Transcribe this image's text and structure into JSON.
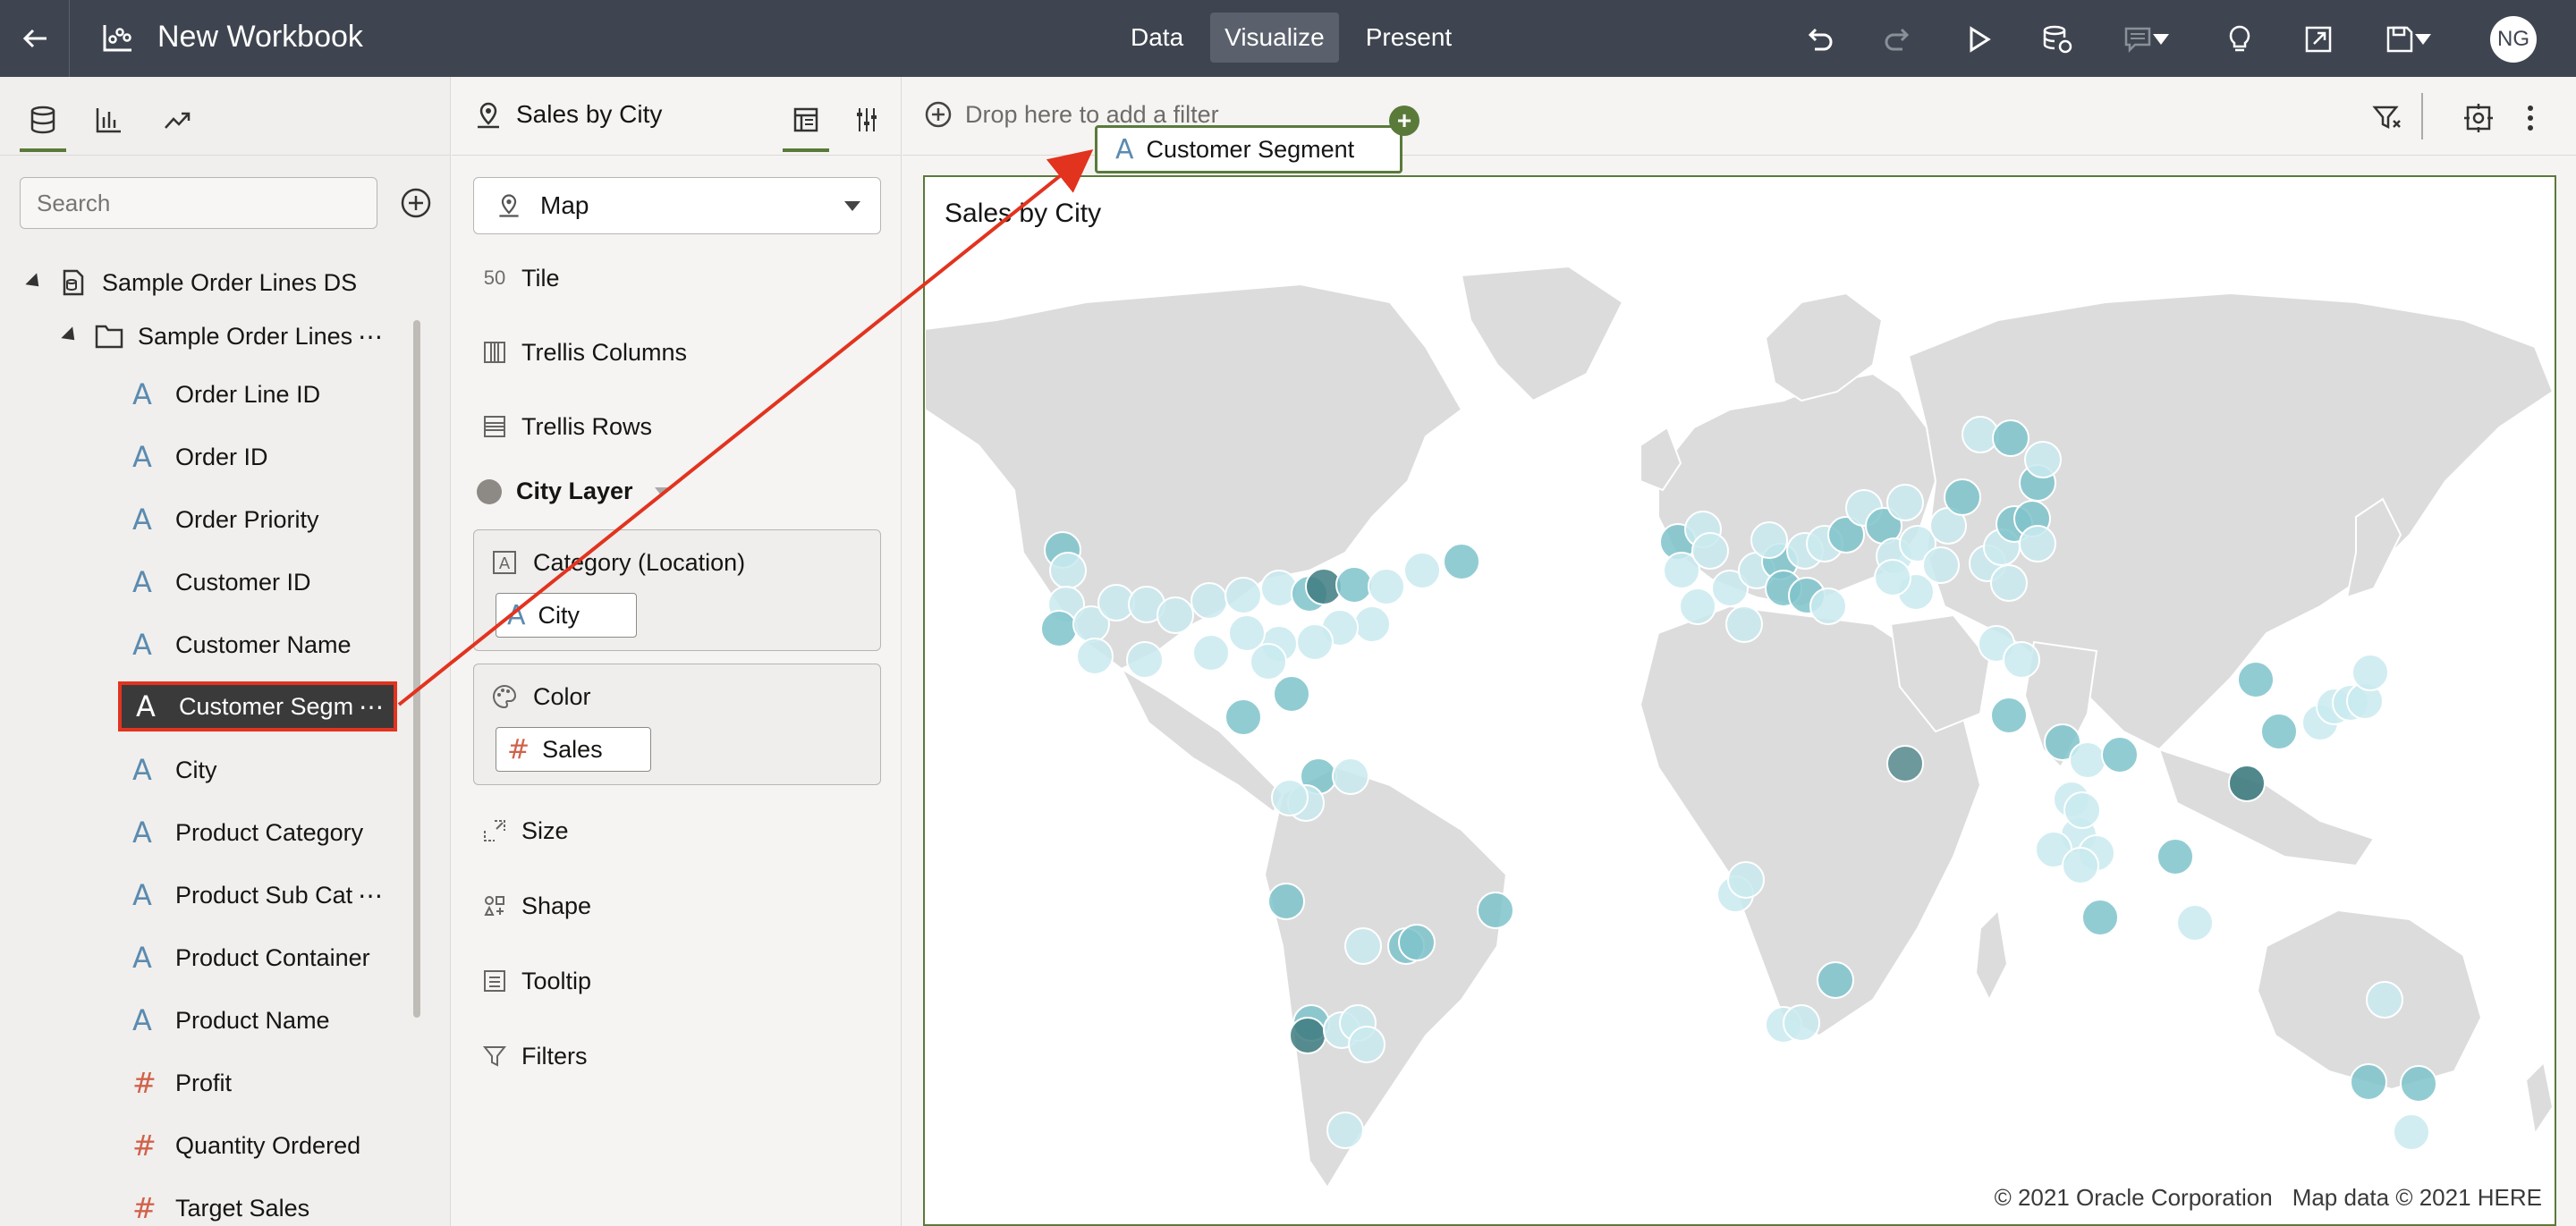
{
  "header": {
    "title": "New Workbook",
    "modes": [
      "Data",
      "Visualize",
      "Present"
    ],
    "active_mode": "Visualize",
    "user_initials": "NG"
  },
  "data_panel": {
    "search_placeholder": "Search",
    "tree": {
      "dataset": "Sample Order Lines DS",
      "table": "Sample Order Lines",
      "fields": [
        {
          "name": "Order Line ID",
          "type": "attribute"
        },
        {
          "name": "Order ID",
          "type": "attribute"
        },
        {
          "name": "Order Priority",
          "type": "attribute"
        },
        {
          "name": "Customer ID",
          "type": "attribute"
        },
        {
          "name": "Customer Name",
          "type": "attribute"
        },
        {
          "name": "Customer Segm",
          "type": "attribute",
          "selected": true
        },
        {
          "name": "City",
          "type": "attribute"
        },
        {
          "name": "Product Category",
          "type": "attribute"
        },
        {
          "name": "Product Sub Cat",
          "type": "attribute"
        },
        {
          "name": "Product Container",
          "type": "attribute"
        },
        {
          "name": "Product Name",
          "type": "attribute"
        },
        {
          "name": "Profit",
          "type": "measure"
        },
        {
          "name": "Quantity Ordered",
          "type": "measure"
        },
        {
          "name": "Target Sales",
          "type": "measure"
        }
      ]
    }
  },
  "grammar": {
    "title": "Sales by City",
    "viz_type": "Map",
    "rows": [
      "Tile",
      "Trellis Columns",
      "Trellis Rows"
    ],
    "layer": "City Layer",
    "category_label": "Category (Location)",
    "category_value": "City",
    "color_label": "Color",
    "color_value": "Sales",
    "extra_rows": [
      "Size",
      "Shape",
      "Tooltip",
      "Filters"
    ],
    "tile_glyph": "50"
  },
  "canvas": {
    "filter_hint": "Drop here to add a filter",
    "drag_chip": "Customer Segment",
    "viz_title": "Sales by City",
    "attribution": [
      "© 2021 Oracle Corporation",
      "Map data © 2021 HERE"
    ]
  },
  "colors": {
    "topbar": "#3f4550",
    "accent": "#5a7a3a",
    "highlight": "#e2331f",
    "attribute": "#5b8bb0",
    "measure": "#d0624b",
    "land": "#dcdcdc",
    "bubble_light": "#c9eaee",
    "bubble_mid": "#7fc3cb",
    "bubble_dark": "#3d7b80"
  }
}
